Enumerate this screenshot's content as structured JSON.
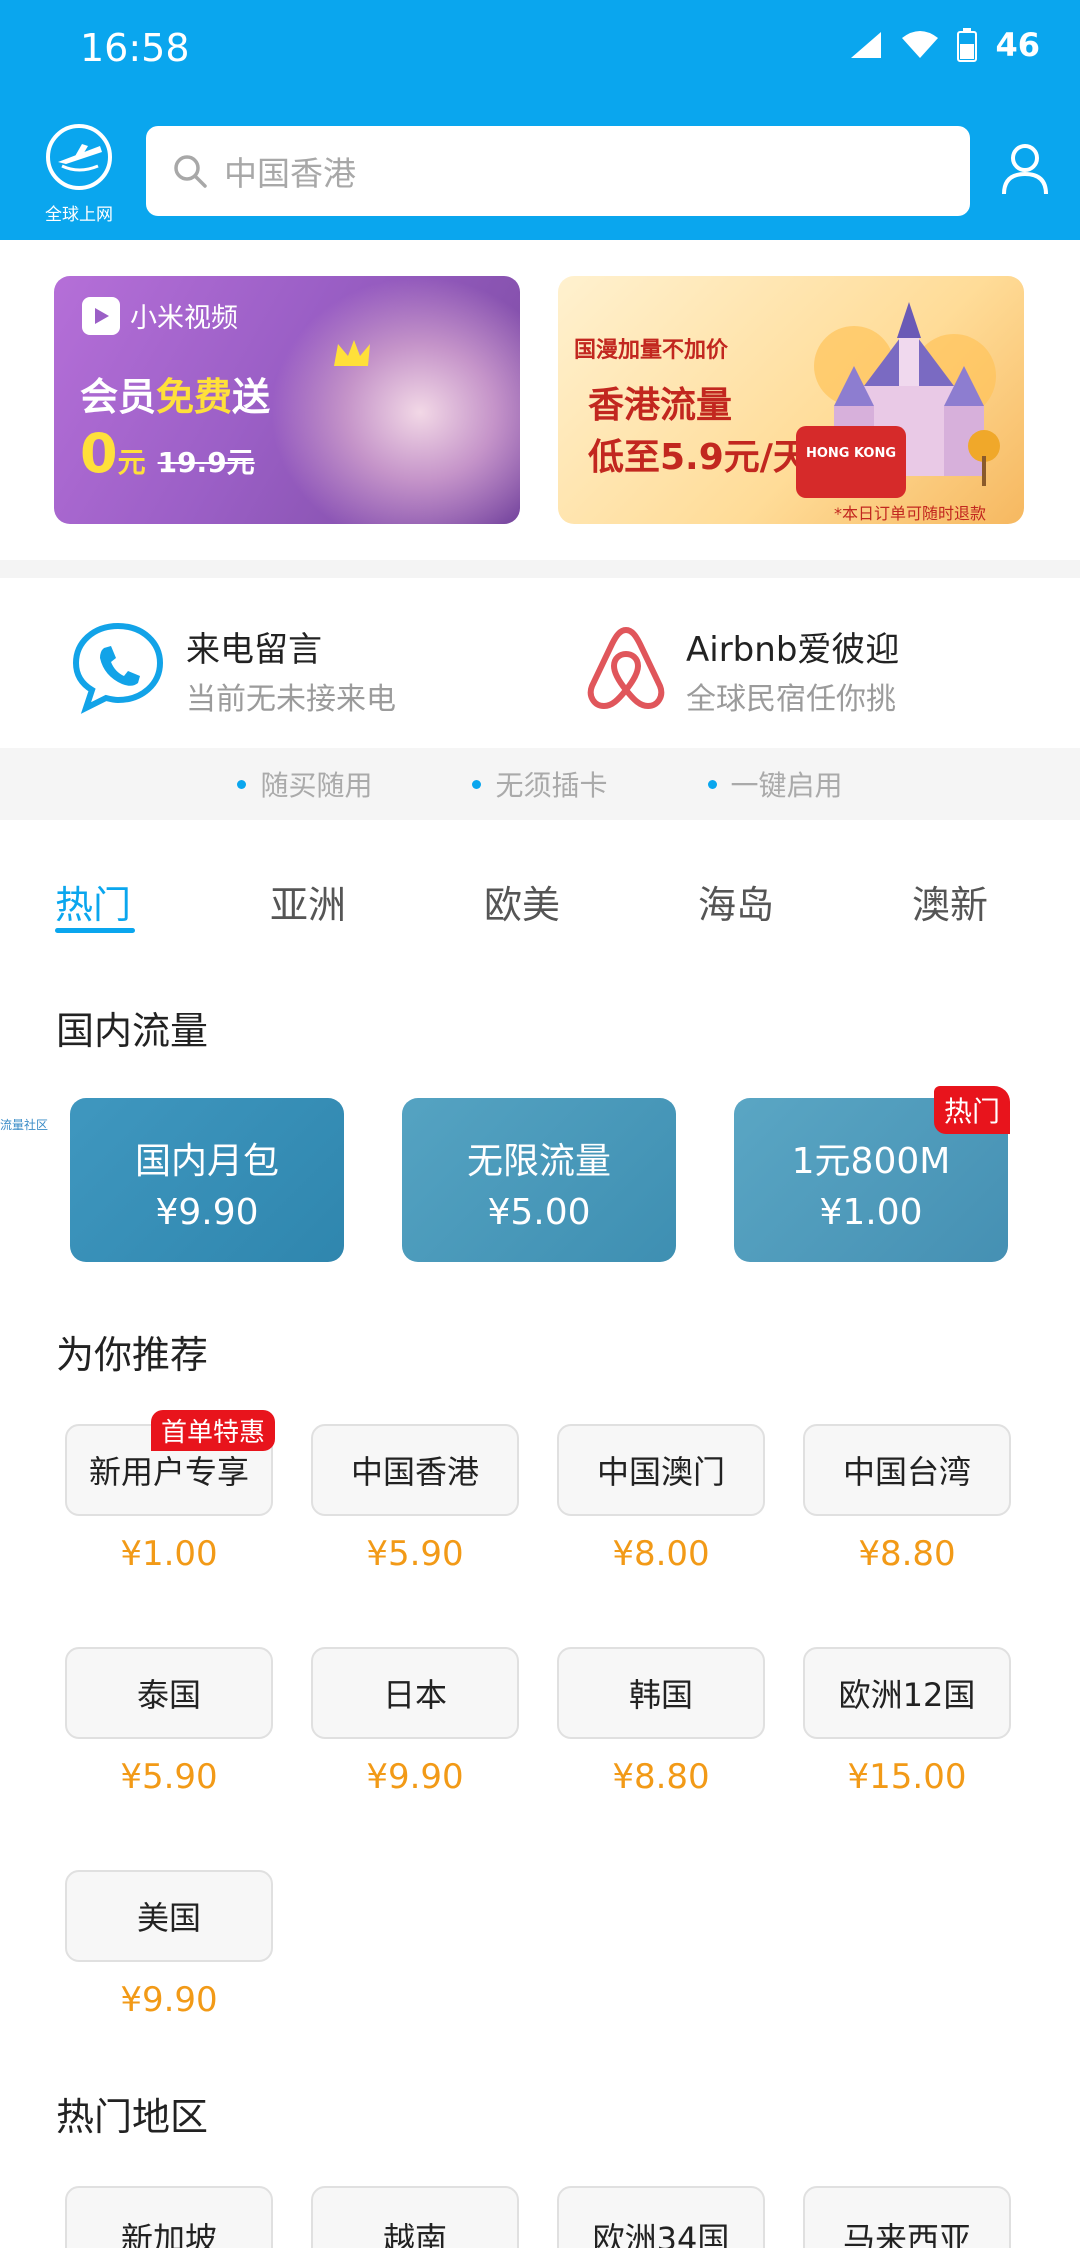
{
  "status_bar": {
    "time": "16:58",
    "battery": "46"
  },
  "header": {
    "logo_label": "全球上网",
    "search_placeholder": "中国香港"
  },
  "banners": {
    "left": {
      "brand": "小米视频",
      "line1_a": "会员",
      "line1_b": "免费",
      "line1_c": "送",
      "price": "0",
      "unit": "元",
      "old_price": "19.9元"
    },
    "right": {
      "top": "国漫加量不加价",
      "line1": "香港流量",
      "line2": "低至5.9元/天",
      "bus_text": "HONG KONG",
      "note": "*本日订单可随时退款"
    }
  },
  "services": [
    {
      "title": "来电留言",
      "subtitle": "当前无未接来电",
      "icon": "phone-chat-icon"
    },
    {
      "title": "Airbnb爱彼迎",
      "subtitle": "全球民宿任你挑",
      "icon": "airbnb-icon"
    }
  ],
  "features": [
    "随买随用",
    "无须插卡",
    "一键启用"
  ],
  "tabs": [
    "热门",
    "亚洲",
    "欧美",
    "海岛",
    "澳新"
  ],
  "active_tab": "热门",
  "sections": {
    "domestic": "国内流量",
    "recommended": "为你推荐",
    "hot_areas": "热门地区"
  },
  "side_tag": "流量社区",
  "domestic_cards": [
    {
      "name": "国内月包",
      "price": "¥9.90",
      "badge": ""
    },
    {
      "name": "无限流量",
      "price": "¥5.00",
      "badge": ""
    },
    {
      "name": "1元800M",
      "price": "¥1.00",
      "badge": "热门"
    }
  ],
  "recommended": [
    {
      "name": "新用户专享",
      "price": "¥1.00",
      "badge": "首单特惠"
    },
    {
      "name": "中国香港",
      "price": "¥5.90"
    },
    {
      "name": "中国澳门",
      "price": "¥8.00"
    },
    {
      "name": "中国台湾",
      "price": "¥8.80"
    },
    {
      "name": "泰国",
      "price": "¥5.90"
    },
    {
      "name": "日本",
      "price": "¥9.90"
    },
    {
      "name": "韩国",
      "price": "¥8.80"
    },
    {
      "name": "欧洲12国",
      "price": "¥15.00"
    },
    {
      "name": "美国",
      "price": "¥9.90"
    }
  ],
  "hot_areas": [
    "新加坡",
    "越南",
    "欧洲34国",
    "马来西亚"
  ],
  "colors": {
    "primary": "#0aa6ee",
    "price": "#f29a17",
    "badge": "#e8141c"
  }
}
